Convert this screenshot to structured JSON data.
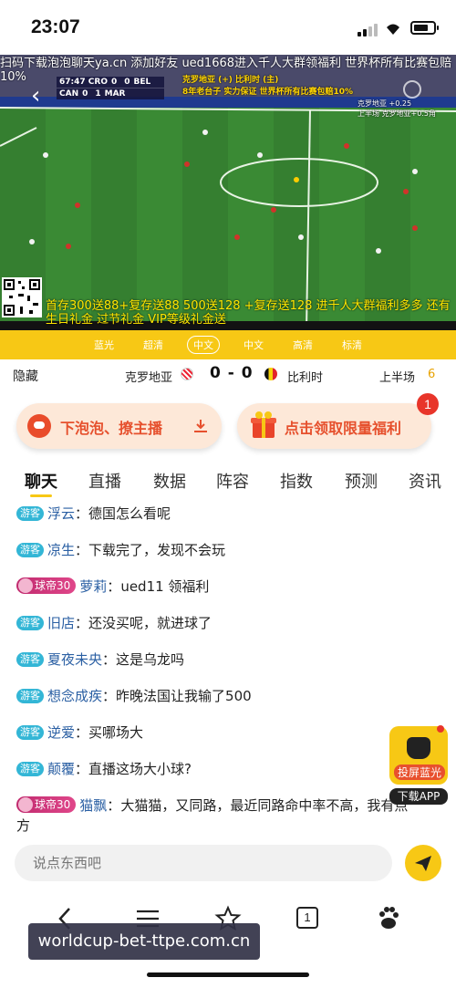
{
  "status": {
    "time": "23:07",
    "battery_level": 0.75
  },
  "video": {
    "marquee": "扫码下载泡泡聊天ya.cn 添加好友 ued1668进入千人大群领福利 世界杯所有比赛包赔10%",
    "scoreboard": {
      "clock": "67:47",
      "row1": {
        "home": "CRO",
        "home_score": "0",
        "away_score": "0",
        "away": "BEL"
      },
      "row2": {
        "home": "CAN",
        "home_score": "0",
        "away_score": "1",
        "away": "MAR"
      }
    },
    "ad_top_line1": "克罗地亚 (+) 比利时 (主)",
    "ad_top_line2": "8年老台子 实力保证 世界杯所有比赛包赔10%",
    "ad_right_line1": "克罗地亚 +0.25",
    "ad_right_line2": "上半场 克罗地亚+0.5角",
    "qr_caption": "首存300送88+复存送88 500送128 +复存送128 进千人大群福利多多 还有生日礼金 过节礼金 VIP等级礼金送"
  },
  "quality": {
    "options": [
      "蓝光",
      "超清",
      "中文",
      "中文",
      "高清",
      "标清"
    ],
    "active_index": 2
  },
  "match": {
    "hide_label": "隐藏",
    "home_team": "克罗地亚",
    "score": "0 - 0",
    "away_team": "比利时",
    "period": "上半场",
    "period_num": "6"
  },
  "promos": {
    "left_label": "下泡泡、撩主播",
    "right_label": "点击领取限量福利",
    "badge": "1"
  },
  "tabs": [
    "聊天",
    "直播",
    "数据",
    "阵容",
    "指数",
    "预测",
    "资讯"
  ],
  "chat": {
    "guest_tag": "游客",
    "vip_tag": "球帝30",
    "messages": [
      {
        "user": "浮云",
        "text": "德国怎么看呢",
        "vip": false
      },
      {
        "user": "凉生",
        "text": "下载完了，发现不会玩",
        "vip": false
      },
      {
        "user": "萝莉",
        "text": "ued11 领福利",
        "vip": true
      },
      {
        "user": "旧店",
        "text": "还没买呢，就进球了",
        "vip": false
      },
      {
        "user": "夏夜未央",
        "text": "这是乌龙吗",
        "vip": false
      },
      {
        "user": "想念成疾",
        "text": "昨晚法国让我输了500",
        "vip": false
      },
      {
        "user": "逆爱",
        "text": "买哪场大",
        "vip": false
      },
      {
        "user": "颠覆",
        "text": "直播这场大小球?",
        "vip": false
      },
      {
        "user": "猫飘",
        "text": "大猫猫，又同路，最近同路命中率不高，我有点方",
        "vip": true
      }
    ]
  },
  "float_app": {
    "label": "投屏蓝光",
    "title": "下载APP"
  },
  "input": {
    "placeholder": "说点东西吧"
  },
  "browser": {
    "tab_count": "1",
    "watermark": "worldcup-bet-ttpe.com.cn"
  }
}
